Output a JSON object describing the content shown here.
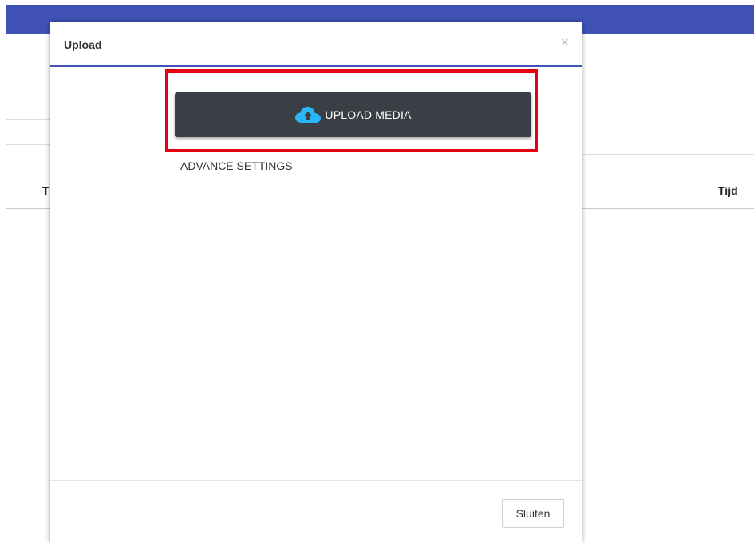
{
  "background": {
    "column_left_label": "T",
    "column_right_label": "Tijd"
  },
  "modal": {
    "title": "Upload",
    "close_glyph": "×",
    "upload_button_label": "UPLOAD MEDIA",
    "upload_icon": "cloud-upload-icon",
    "advanced_link": "ADVANCE SETTINGS",
    "footer_close_label": "Sluiten"
  },
  "colors": {
    "topbar": "#3f51b5",
    "upload_button": "#3a3f46",
    "cloud_icon": "#29b6f6",
    "highlight": "#e60012"
  }
}
